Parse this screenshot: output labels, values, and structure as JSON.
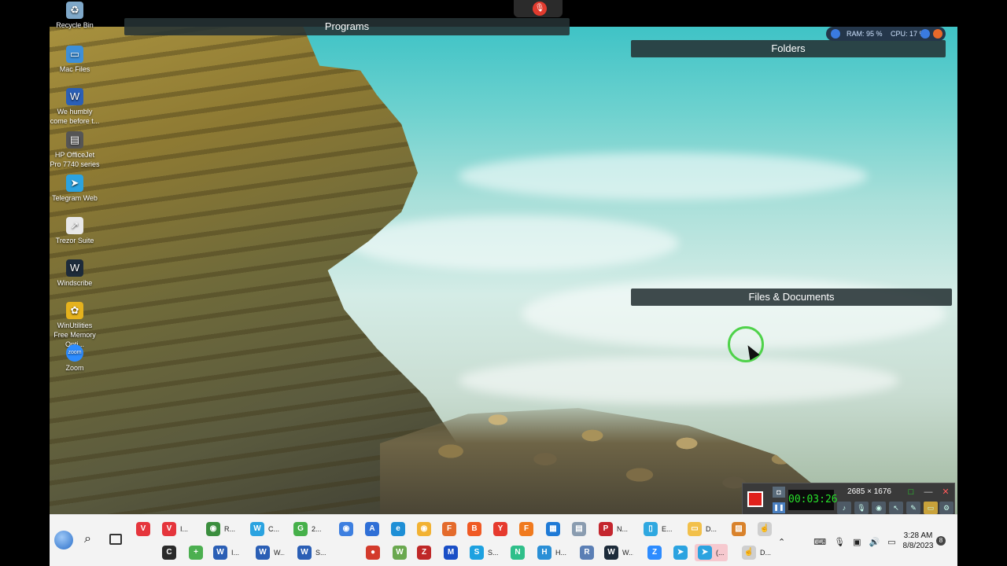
{
  "desktop_icons": [
    {
      "name": "desk-icon-recycle-bin",
      "icon": "recycle-bin-icon",
      "label": "Recycle Bin",
      "color": "#7fa8c9"
    },
    {
      "name": "desk-icon-mac-files",
      "icon": "folder-icon",
      "label": "Mac Files",
      "color": "#3d8fd8"
    },
    {
      "name": "desk-icon-word-doc",
      "icon": "word-document-icon",
      "label": "We humbly come before t...",
      "color": "#2b5fb5"
    },
    {
      "name": "desk-icon-printer",
      "icon": "printer-icon",
      "label": "HP OfficeJet Pro 7740 series",
      "color": "#555555"
    },
    {
      "name": "desk-icon-telegram",
      "icon": "telegram-icon",
      "label": "Telegram Web",
      "color": "#2ba3e0"
    },
    {
      "name": "desk-icon-trezor",
      "icon": "shortcut-file-icon",
      "label": "Trezor Suite",
      "color": "#e8e8e8"
    },
    {
      "name": "desk-icon-windscribe",
      "icon": "windscribe-icon",
      "label": "Windscribe",
      "color": "#1d2b3a"
    },
    {
      "name": "desk-icon-winutilities",
      "icon": "winutilities-icon",
      "label": "WinUtilities Free Memory Opti...",
      "color": "#e5b21d"
    },
    {
      "name": "desk-icon-zoom",
      "icon": "zoom-icon",
      "label": "Zoom",
      "color": "#2d8cff"
    }
  ],
  "fences": {
    "programs": "Programs",
    "folders": "Folders",
    "files": "Files & Documents"
  },
  "system_monitor": {
    "ram": "RAM: 95 %",
    "cpu": "CPU: 17 %"
  },
  "recorder": {
    "timer": "00:03:26",
    "dimensions": "2685 × 1676"
  },
  "taskbar_row1": [
    {
      "name": "tb-vivaldi-1",
      "icon": "vivaldi-icon",
      "label": "",
      "color": "#e5353c",
      "glyph": "V"
    },
    {
      "name": "tb-vivaldi-2",
      "icon": "vivaldi-icon",
      "label": "I...",
      "color": "#e5353c",
      "glyph": "V"
    },
    {
      "name": "tb-chrome",
      "icon": "chrome-icon",
      "label": "R...",
      "color": "#3b8e3e",
      "glyph": "◉"
    },
    {
      "name": "tb-windscribe-c",
      "icon": "windscribe-icon",
      "label": "C...",
      "color": "#2ba3e0",
      "glyph": "W"
    },
    {
      "name": "tb-greenapp",
      "icon": "green-app-icon",
      "label": "2...",
      "color": "#46b04a",
      "glyph": "G"
    },
    {
      "name": "tb-chrome-blue",
      "icon": "chrome-beta-icon",
      "label": "",
      "color": "#3d7fe0",
      "glyph": "◉"
    },
    {
      "name": "tb-a-app",
      "icon": "a-app-icon",
      "label": "",
      "color": "#2f6fd6",
      "glyph": "A"
    },
    {
      "name": "tb-edge",
      "icon": "edge-icon",
      "label": "",
      "color": "#1e8fd6",
      "glyph": "e"
    },
    {
      "name": "tb-chrome-canary",
      "icon": "chrome-canary-icon",
      "label": "",
      "color": "#f2b233",
      "glyph": "◉"
    },
    {
      "name": "tb-firefox-dev",
      "icon": "firefox-icon",
      "label": "",
      "color": "#e46b2c",
      "glyph": "F"
    },
    {
      "name": "tb-brave",
      "icon": "brave-icon",
      "label": "",
      "color": "#f05a24",
      "glyph": "B"
    },
    {
      "name": "tb-yandex",
      "icon": "yandex-icon",
      "label": "",
      "color": "#e63a2e",
      "glyph": "Y"
    },
    {
      "name": "tb-firefox",
      "icon": "firefox-icon",
      "label": "",
      "color": "#f07a1e",
      "glyph": "F"
    },
    {
      "name": "tb-store",
      "icon": "microsoft-store-icon",
      "label": "",
      "color": "#1f7ad6",
      "glyph": "▦"
    },
    {
      "name": "tb-chart-app",
      "icon": "chart-app-icon",
      "label": "",
      "color": "#8a9cb0",
      "glyph": "▤"
    },
    {
      "name": "tb-pdf",
      "icon": "pdf-icon",
      "label": "N...",
      "color": "#c4262e",
      "glyph": "P"
    },
    {
      "name": "tb-notes",
      "icon": "notes-icon",
      "label": "E...",
      "color": "#2fa8e0",
      "glyph": "▯"
    },
    {
      "name": "tb-explorer",
      "icon": "file-explorer-icon",
      "label": "D...",
      "color": "#f2c04a",
      "glyph": "▭"
    },
    {
      "name": "tb-photos",
      "icon": "photos-icon",
      "label": "",
      "color": "#d9822b",
      "glyph": "▨"
    },
    {
      "name": "tb-touch",
      "icon": "touch-icon",
      "label": "",
      "color": "#cfcfcf",
      "glyph": "☝"
    }
  ],
  "taskbar_row2": [
    {
      "name": "tb-cortana",
      "icon": "cortana-icon",
      "label": "",
      "color": "#2a2a2a",
      "glyph": "C"
    },
    {
      "name": "tb-plus-app",
      "icon": "plus-app-icon",
      "label": "",
      "color": "#4caf50",
      "glyph": "+"
    },
    {
      "name": "tb-word-1",
      "icon": "word-icon",
      "label": "I...",
      "color": "#2b5fb5",
      "glyph": "W"
    },
    {
      "name": "tb-word-2",
      "icon": "word-icon",
      "label": "W...",
      "color": "#2b5fb5",
      "glyph": "W"
    },
    {
      "name": "tb-word-3",
      "icon": "word-icon",
      "label": "S...",
      "color": "#2b5fb5",
      "glyph": "W"
    },
    {
      "name": "tb-recorder",
      "icon": "record-icon",
      "label": "",
      "color": "#d33b2c",
      "glyph": "●"
    },
    {
      "name": "tb-w-app",
      "icon": "w-app-icon",
      "label": "",
      "color": "#6aa84f",
      "glyph": "W"
    },
    {
      "name": "tb-filezilla",
      "icon": "filezilla-icon",
      "label": "",
      "color": "#bf2828",
      "glyph": "Z"
    },
    {
      "name": "tb-malwarebytes",
      "icon": "malwarebytes-icon",
      "label": "",
      "color": "#1a4fc6",
      "glyph": "M"
    },
    {
      "name": "tb-skype",
      "icon": "skype-icon",
      "label": "S...",
      "color": "#1da1e0",
      "glyph": "S"
    },
    {
      "name": "tb-n-app",
      "icon": "n-app-icon",
      "label": "",
      "color": "#2fbf8a",
      "glyph": "N"
    },
    {
      "name": "tb-h-app",
      "icon": "h-app-icon",
      "label": "H...",
      "color": "#2a8fd6",
      "glyph": "H"
    },
    {
      "name": "tb-r-app",
      "icon": "r-app-icon",
      "label": "",
      "color": "#5b7fb5",
      "glyph": "R"
    },
    {
      "name": "tb-windscribe-w",
      "icon": "windscribe-icon",
      "label": "W...",
      "color": "#1d2b3a",
      "glyph": "W"
    },
    {
      "name": "tb-zoom",
      "icon": "zoom-icon",
      "label": "",
      "color": "#2d8cff",
      "glyph": "Z"
    },
    {
      "name": "tb-telegram-1",
      "icon": "telegram-icon",
      "label": "",
      "color": "#2ba3e0",
      "glyph": "➤"
    },
    {
      "name": "tb-telegram-2",
      "icon": "telegram-icon",
      "label": "(...",
      "color": "#2ba3e0",
      "glyph": "➤",
      "active": true
    },
    {
      "name": "tb-touch-d",
      "icon": "touch-icon",
      "label": "D...",
      "color": "#cfcfcf",
      "glyph": "☝"
    }
  ],
  "clock": {
    "time": "3:28 AM",
    "date": "8/8/2023"
  },
  "notifications_count": "8"
}
